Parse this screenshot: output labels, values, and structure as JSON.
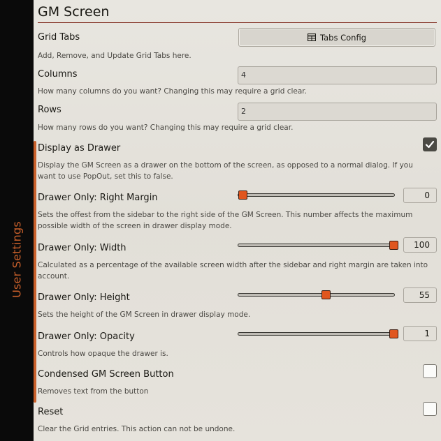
{
  "sidebar": {
    "label": "User Settings"
  },
  "page": {
    "title": "GM Screen"
  },
  "settings": {
    "grid_tabs": {
      "label": "Grid Tabs",
      "button_label": "Tabs Config",
      "button_icon": "table-icon",
      "hint": "Add, Remove, and Update Grid Tabs here."
    },
    "columns": {
      "label": "Columns",
      "value": "4",
      "hint": "How many columns do you want? Changing this may require a grid clear."
    },
    "rows": {
      "label": "Rows",
      "value": "2",
      "hint": "How many rows do you want? Changing this may require a grid clear."
    },
    "display_as_drawer": {
      "label": "Display as Drawer",
      "checked": true,
      "hint": "Display the GM Screen as a drawer on the bottom of the screen, as opposed to a normal dialog. If you want to use PopOut, set this to false."
    },
    "right_margin": {
      "label": "Drawer Only: Right Margin",
      "value": "0",
      "slider_fraction": 0.0,
      "hint": "Sets the offest from the sidebar to the right side of the GM Screen. This number affects the maximum possible width of the screen in drawer display mode."
    },
    "width": {
      "label": "Drawer Only: Width",
      "value": "100",
      "slider_fraction": 1.0,
      "hint": "Calculated as a percentage of the available screen width after the sidebar and right margin are taken into account."
    },
    "height": {
      "label": "Drawer Only: Height",
      "value": "55",
      "slider_fraction": 0.55,
      "hint": "Sets the height of the GM Screen in drawer display mode."
    },
    "opacity": {
      "label": "Drawer Only: Opacity",
      "value": "1",
      "slider_fraction": 1.0,
      "hint": "Controls how opaque the drawer is."
    },
    "condensed_button": {
      "label": "Condensed GM Screen Button",
      "checked": false,
      "hint": "Removes text from the button"
    },
    "reset": {
      "label": "Reset",
      "checked": false,
      "hint": "Clear the Grid entries. This action can not be undone."
    }
  },
  "colors": {
    "accent": "#c9602b",
    "slider_thumb": "#e0561f",
    "title_rule": "#7a1f13"
  }
}
